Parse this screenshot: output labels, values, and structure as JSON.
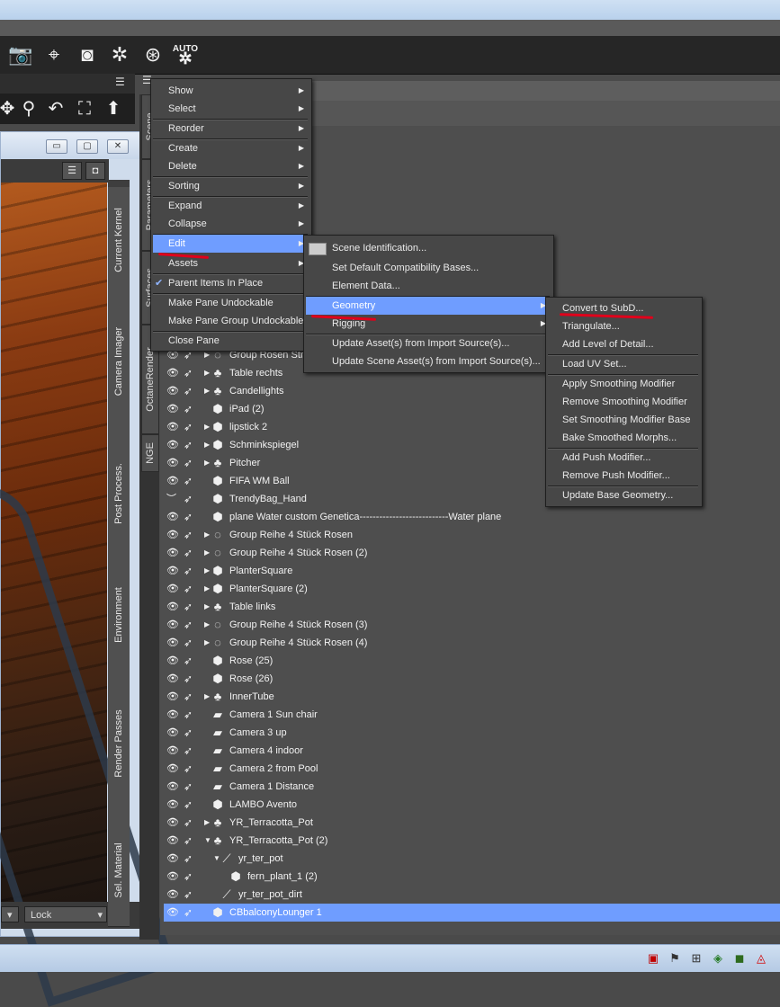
{
  "viewport": {
    "window_buttons": [
      "▭",
      "▢",
      "✕"
    ],
    "bottom_lock_label": "Lock",
    "side_tabs": [
      "Current Kernel",
      "Camera Imager",
      "Post Process.",
      "Environment",
      "Render Passes",
      "Sel. Material"
    ]
  },
  "scene_tabs": [
    "Scene",
    "Parameters",
    "Surfaces",
    "OctaneRender",
    "NGE"
  ],
  "context_menu": {
    "items": [
      {
        "label": "Show",
        "submenu": true
      },
      {
        "label": "Select",
        "submenu": true
      },
      {
        "label": "Reorder",
        "submenu": true
      },
      {
        "label": "Create",
        "submenu": true
      },
      {
        "label": "Delete",
        "submenu": true
      },
      {
        "label": "Sorting",
        "submenu": true
      },
      {
        "label": "Expand",
        "submenu": true
      },
      {
        "label": "Collapse",
        "submenu": true
      },
      {
        "label": "Edit",
        "submenu": true,
        "highlighted": true
      },
      {
        "label": "Assets",
        "submenu": true
      },
      {
        "label": "Parent Items In Place",
        "checked": true
      },
      {
        "label": "Make Pane Undockable"
      },
      {
        "label": "Make Pane Group Undockable"
      },
      {
        "label": "Close Pane"
      }
    ]
  },
  "edit_submenu": {
    "items": [
      {
        "label": "Scene Identification..."
      },
      {
        "label": "Set Default Compatibility Bases..."
      },
      {
        "label": "Element Data..."
      },
      {
        "label": "Geometry",
        "submenu": true,
        "highlighted": true
      },
      {
        "label": "Rigging",
        "submenu": true
      },
      {
        "label": "Update Asset(s) from Import Source(s)..."
      },
      {
        "label": "Update Scene Asset(s) from Import Source(s)..."
      }
    ]
  },
  "geometry_submenu": {
    "items": [
      {
        "label": "Convert to SubD..."
      },
      {
        "label": "Triangulate..."
      },
      {
        "label": "Add Level of Detail..."
      },
      {
        "label": "Load UV Set..."
      },
      {
        "label": "Apply Smoothing Modifier"
      },
      {
        "label": "Remove Smoothing Modifier"
      },
      {
        "label": "Set Smoothing Modifier Base"
      },
      {
        "label": "Bake Smoothed Morphs..."
      },
      {
        "label": "Add Push Modifier..."
      },
      {
        "label": "Remove Push Modifier..."
      },
      {
        "label": "Update Base Geometry..."
      }
    ]
  },
  "scene_rows": [
    {
      "label": "Group Rosen Str",
      "icon": "group-icon",
      "expander": "▶",
      "indent": 0
    },
    {
      "label": "Table rechts",
      "icon": "figure-group-icon",
      "expander": "▶",
      "indent": 0
    },
    {
      "label": "Candellights",
      "icon": "figure-group-icon",
      "expander": "▶",
      "indent": 0
    },
    {
      "label": "iPad (2)",
      "icon": "prop-icon",
      "expander": "",
      "indent": 0
    },
    {
      "label": "lipstick 2",
      "icon": "prop-icon",
      "expander": "▶",
      "indent": 0
    },
    {
      "label": "Schminkspiegel",
      "icon": "prop-icon",
      "expander": "▶",
      "indent": 0
    },
    {
      "label": "Pitcher",
      "icon": "figure-group-icon",
      "expander": "▶",
      "indent": 0
    },
    {
      "label": "FIFA WM Ball",
      "icon": "prop-icon",
      "expander": "",
      "indent": 0
    },
    {
      "label": "TrendyBag_Hand",
      "icon": "prop-icon",
      "expander": "",
      "indent": 0,
      "hidden": true
    },
    {
      "label": "plane Water custom Genetica---------------------------Water plane",
      "icon": "prop-icon",
      "expander": "",
      "indent": 0
    },
    {
      "label": "Group Reihe 4 Stück Rosen",
      "icon": "group-icon",
      "expander": "▶",
      "indent": 0
    },
    {
      "label": "Group Reihe 4 Stück Rosen (2)",
      "icon": "group-icon",
      "expander": "▶",
      "indent": 0
    },
    {
      "label": "PlanterSquare",
      "icon": "prop-icon",
      "expander": "▶",
      "indent": 0
    },
    {
      "label": "PlanterSquare (2)",
      "icon": "prop-icon",
      "expander": "▶",
      "indent": 0
    },
    {
      "label": "Table links",
      "icon": "figure-group-icon",
      "expander": "▶",
      "indent": 0
    },
    {
      "label": "Group Reihe 4 Stück Rosen (3)",
      "icon": "group-icon",
      "expander": "▶",
      "indent": 0
    },
    {
      "label": "Group Reihe 4 Stück Rosen (4)",
      "icon": "group-icon",
      "expander": "▶",
      "indent": 0
    },
    {
      "label": "Rose (25)",
      "icon": "prop-icon",
      "expander": "",
      "indent": 0
    },
    {
      "label": "Rose (26)",
      "icon": "prop-icon",
      "expander": "",
      "indent": 0
    },
    {
      "label": "InnerTube",
      "icon": "figure-group-icon",
      "expander": "▶",
      "indent": 0
    },
    {
      "label": "Camera 1 Sun chair",
      "icon": "camera-icon",
      "expander": "",
      "indent": 0
    },
    {
      "label": "Camera 3 up",
      "icon": "camera-icon",
      "expander": "",
      "indent": 0
    },
    {
      "label": "Camera 4 indoor",
      "icon": "camera-icon",
      "expander": "",
      "indent": 0
    },
    {
      "label": "Camera 2 from Pool",
      "icon": "camera-icon",
      "expander": "",
      "indent": 0
    },
    {
      "label": "Camera 1 Distance",
      "icon": "camera-icon",
      "expander": "",
      "indent": 0
    },
    {
      "label": "LAMBO Avento",
      "icon": "prop-icon",
      "expander": "",
      "indent": 0
    },
    {
      "label": "YR_Terracotta_Pot",
      "icon": "figure-group-icon",
      "expander": "▶",
      "indent": 0
    },
    {
      "label": "YR_Terracotta_Pot (2)",
      "icon": "figure-group-icon",
      "expander": "▼",
      "indent": 0
    },
    {
      "label": "yr_ter_pot",
      "icon": "bone-icon",
      "expander": "▼",
      "indent": 1
    },
    {
      "label": "fern_plant_1 (2)",
      "icon": "prop-icon",
      "expander": "",
      "indent": 2
    },
    {
      "label": "yr_ter_pot_dirt",
      "icon": "bone-icon",
      "expander": "",
      "indent": 1
    },
    {
      "label": "CBbalconyLounger 1",
      "icon": "prop-icon",
      "expander": "",
      "indent": 0,
      "selected": true
    }
  ],
  "toolbar_icons": [
    "camera-icon",
    "pointer-settings-icon",
    "render-camera-icon",
    "aperture-icon",
    "aperture-settings-icon",
    "auto-render-icon"
  ],
  "auto_label": "AUTO",
  "nav_icons": [
    "move-icon",
    "zoom-icon",
    "orbit-icon",
    "frame-icon",
    "up-icon"
  ],
  "colors": {
    "highlight": "#6f9dff",
    "annotation": "#e0001b"
  }
}
